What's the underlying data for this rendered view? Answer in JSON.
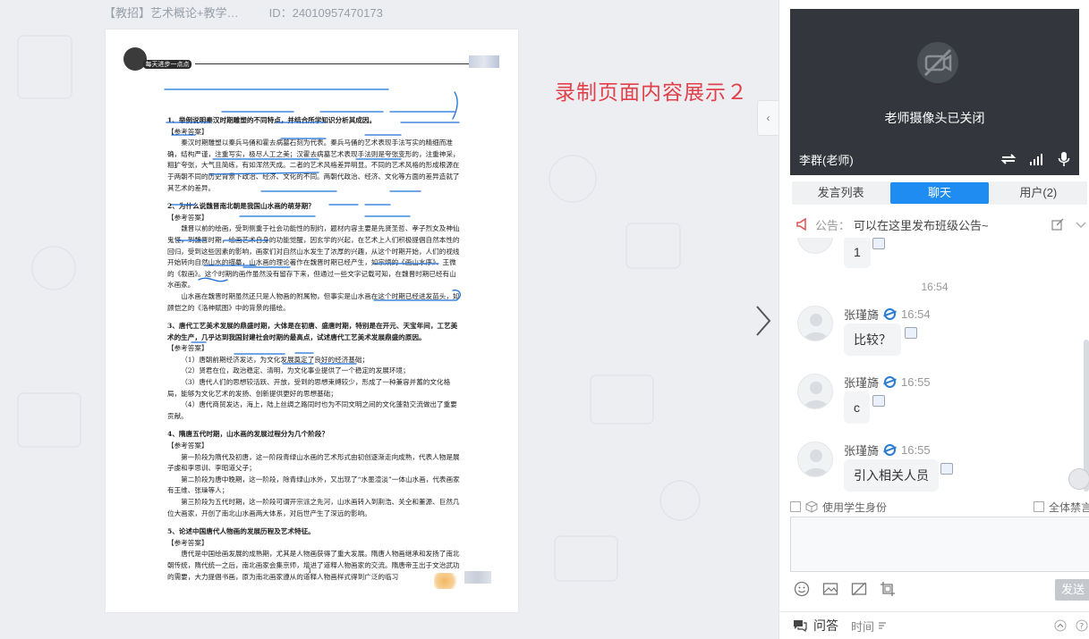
{
  "topbar": {
    "course": "【教招】艺术概论+教学…",
    "id": "ID：24010957470173"
  },
  "document": {
    "header_tag": "每天进步一点点",
    "page_number": "1",
    "paragraphs": [
      {
        "cls": "q",
        "text": "1、举例说明秦汉时期雕塑的不同特点，并结合所学知识分析其成因。"
      },
      {
        "cls": "ref",
        "text": "【参考答案】"
      },
      {
        "cls": "indent",
        "text": "秦汉时期雕塑以秦兵马俑和霍去病墓石刻为代表。秦兵马俑的艺术表现手法写实的精细而准确，结构严谨，注重写实，极尽人工之美；汉霍去病墓艺术表现手法则是夸张变形的，注重神采，粗犷夸张，大气且简练，有如浑然天成。二者的艺术风格差异明显。不同的艺术风格的形成根源在于两朝不同的历史背景下政治、经济、文化的不同。两朝代政治、经济、文化等方面的差异造就了其艺术的差异。"
      },
      {
        "cls": "q",
        "text": "2、为什么说魏晋南北朝是我国山水画的萌芽期？"
      },
      {
        "cls": "ref",
        "text": "【参考答案】"
      },
      {
        "cls": "indent",
        "text": "魏晋以前的绘画，受到侧重于社会功能性的制约，题材内容主要是先贤圣哲、孝子烈女及神仙鬼怪，到魏晋时期，绘画艺术自身的功能觉醒，因玄学的兴起，在艺术上人们积极提倡自然本性的回归，受到这些因素的影响，画家们对自然山水发生了浓厚的兴趣，从这个时期开始，人们的视线开始转向自然山水的描摹，山水画的理论著作在魏晋时期已经产生，如宗炳的《画山水序》、王微的《叙画》。这个时期的画作虽然没有留存下来，但通过一些文字记载可知，在魏晋时期已经有山水画家。"
      },
      {
        "cls": "indent",
        "text": "山水画在魏晋时期虽然还只是人物画的附属物，但事实是山水画在这个时期已经进发苗头，如顾恺之的《洛神赋图》中的背景的描绘。"
      },
      {
        "cls": "q",
        "text": "3、唐代工艺美术发展的鼎盛时期，大体是在初唐、盛唐时期，特别是在开元、天宝年间，工艺美术的生产，几乎达到我国封建社会时期的最高点，试述唐代工艺美术发展鼎盛的原因。"
      },
      {
        "cls": "ref",
        "text": "【参考答案】"
      },
      {
        "cls": "indent",
        "text": "（1）唐朝前期经济发达，为文化发展奠定了良好的经济基础；"
      },
      {
        "cls": "indent",
        "text": "（2）贤君在位，政治稳定、清明，为文化事业提供了一个稳定的发展环境；"
      },
      {
        "cls": "indent",
        "text": "（3）唐代人们的思想较活跃、开放，受到的思想束缚较少，形成了一种兼容并蓄的文化格局，能够为文化艺术的发扬、创新提供更好的思想基础；"
      },
      {
        "cls": "indent",
        "text": "（4）唐代商贸发达，海上，陆上丝绸之路同时也为不同文明之间的文化蓬勃交流做出了重要贡献。"
      },
      {
        "cls": "q",
        "text": "4、隋唐五代时期，山水画的发展过程分为几个阶段？"
      },
      {
        "cls": "ref",
        "text": "【参考答案】"
      },
      {
        "cls": "indent",
        "text": "第一阶段为隋代及初唐，这一阶段青绿山水画的艺术形式由初创逐渐走向成熟，代表人物是展子虔和李思训、李昭道父子；"
      },
      {
        "cls": "indent",
        "text": "第二阶段为唐中晚期，这一阶段，除青绿山水外，又出现了“水墨渲淡”一体山水画，代表画家有王维、张璪等人；"
      },
      {
        "cls": "indent",
        "text": "第三阶段为五代时期，这一阶段可谓开宗派之先河，山水画转入到荆浩、关仝和董源、巨然几位大画家，开创了南北山水画两大体系，对后世产生了深远的影响。"
      },
      {
        "cls": "q",
        "text": "5、论述中国唐代人物画的发展历程及艺术特征。"
      },
      {
        "cls": "ref",
        "text": "【参考答案】"
      },
      {
        "cls": "indent",
        "text": "唐代是中国绘画发展的成熟期，尤其是人物画获得了重大发展。隋唐人物画继承和发扬了南北朝传统，隋代统一之后，南北画家会集京师，增进了道释人物画家的交流。隋唐帝王出于文治武功的需要，大力提倡书画，原为南北画家遵从的道释人物画样式得到广泛的临习"
      }
    ]
  },
  "caption": "录制页面内容展示２",
  "video": {
    "camera_off_text": "老师摄像头已关闭",
    "presenter": "李群(老师)"
  },
  "tabs": [
    {
      "label": "发言列表"
    },
    {
      "label": "聊天"
    },
    {
      "label": "用户(2)"
    }
  ],
  "notice": {
    "label": "公告：",
    "text": "可以在这里发布班级公告~"
  },
  "chat": {
    "partial_message": "1",
    "separator": "16:54",
    "messages": [
      {
        "name": "张瑾旖",
        "time": "16:54",
        "text": "比较？"
      },
      {
        "name": "张瑾旖",
        "time": "16:55",
        "text": "c"
      },
      {
        "name": "张瑾旖",
        "time": "16:55",
        "text": "引入相关人员"
      }
    ]
  },
  "options": {
    "student_identity": "使用学生身份",
    "mute_all": "全体禁言"
  },
  "send_label": "发送",
  "footer": {
    "qa": "问答",
    "time": "时间"
  },
  "colors": {
    "accent": "#1e8cf0",
    "caption": "#e2404a",
    "video_bg": "#33373d",
    "ink": "#1f6fd6"
  }
}
